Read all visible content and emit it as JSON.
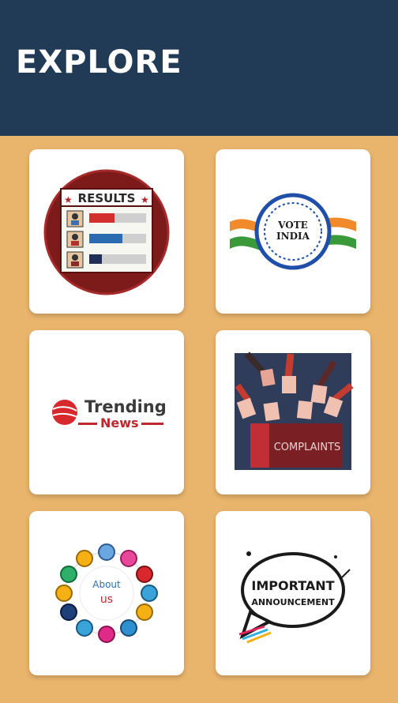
{
  "header": {
    "title": "EXPLORE"
  },
  "tiles": [
    {
      "label": "RESULTS"
    },
    {
      "label_line1": "VOTE",
      "label_line2": "INDIA"
    },
    {
      "label_line1": "Trending",
      "label_line2": "News"
    },
    {
      "label": "COMPLAINTS"
    },
    {
      "label_line1": "About",
      "label_line2": "us"
    },
    {
      "label_line1": "IMPORTANT",
      "label_line2": "ANNOUNCEMENT"
    }
  ],
  "colors": {
    "header_bg": "#213a55",
    "page_bg": "#e9b46c",
    "card_bg": "#ffffff"
  }
}
